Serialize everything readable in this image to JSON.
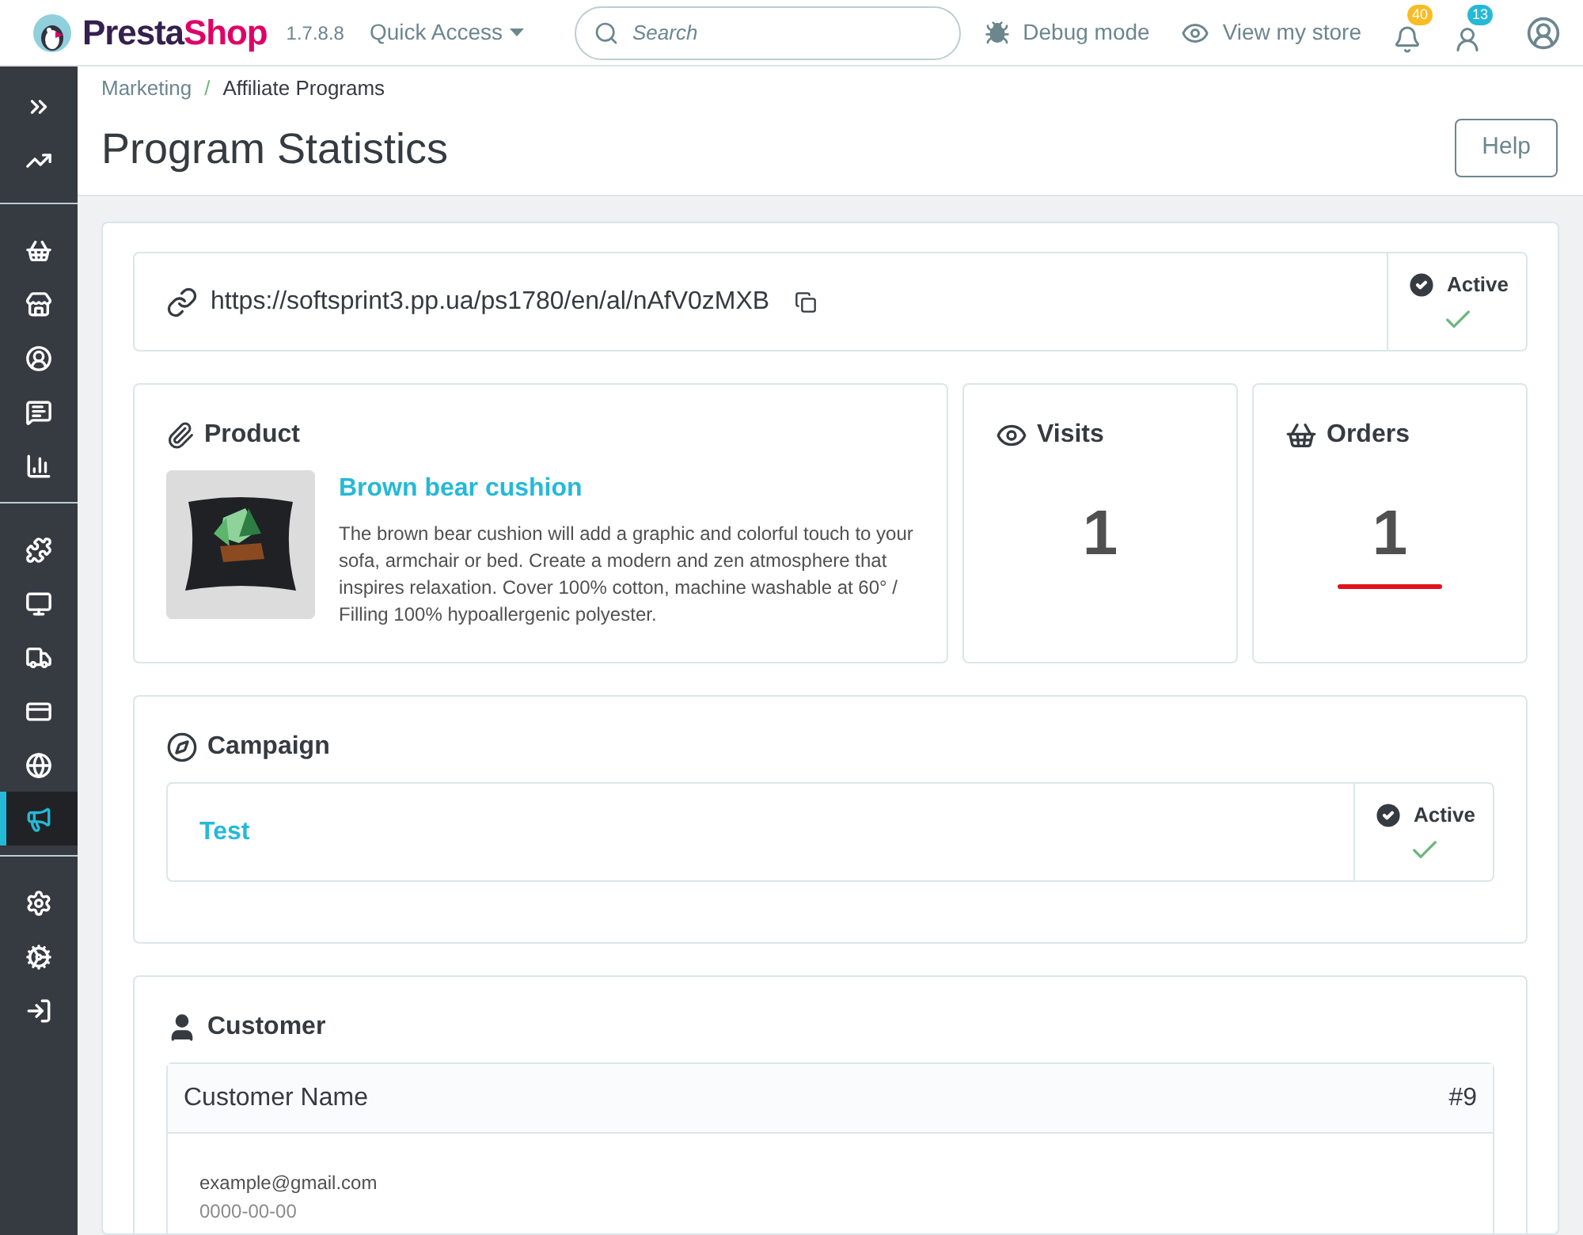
{
  "header": {
    "brand": "PrestaShop",
    "version": "1.7.8.8",
    "quick_access": "Quick Access",
    "search": {
      "placeholder": "Search"
    },
    "debug": "Debug mode",
    "view_store": "View my store",
    "badges": [
      {
        "kind": "bell",
        "count": "40",
        "color": "#fbbb22"
      },
      {
        "kind": "customers",
        "count": "13",
        "color": "#25b9d7"
      }
    ]
  },
  "sidebar": {
    "groups": [
      [
        {
          "kind": "expand",
          "selected": false
        },
        {
          "kind": "stats",
          "selected": false
        }
      ],
      [
        {
          "kind": "orders",
          "selected": false
        },
        {
          "kind": "catalog",
          "selected": false
        },
        {
          "kind": "customers",
          "selected": false
        },
        {
          "kind": "messages",
          "selected": false
        },
        {
          "kind": "reports",
          "selected": false
        }
      ],
      [
        {
          "kind": "modules",
          "selected": false
        },
        {
          "kind": "design",
          "selected": false
        },
        {
          "kind": "shipping",
          "selected": false
        },
        {
          "kind": "payment",
          "selected": false
        },
        {
          "kind": "international",
          "selected": false
        },
        {
          "kind": "marketing",
          "selected": true
        }
      ],
      [
        {
          "kind": "settings",
          "selected": false
        },
        {
          "kind": "advanced",
          "selected": false
        },
        {
          "kind": "logout",
          "selected": false
        }
      ]
    ]
  },
  "breadcrumb": [
    "Marketing",
    "/",
    "Affiliate Programs"
  ],
  "page_title": "Program Statistics",
  "help_button": "Help",
  "link": {
    "url": "https://softsprint3.pp.ua/ps1780/en/al/nAfV0zMXB",
    "status": "Active",
    "active": true
  },
  "product": {
    "heading": "Product",
    "name": "Brown bear cushion",
    "description": "The brown bear cushion will add a graphic and colorful touch to your sofa, armchair or bed. Create a modern and zen atmosphere that inspires relaxation. Cover 100% cotton, machine washable at 60° / Filling 100% hypoallergenic polyester."
  },
  "stats": [
    {
      "kind": "visits",
      "label": "Visits",
      "value": "1"
    },
    {
      "kind": "orders",
      "label": "Orders",
      "value": "1"
    }
  ],
  "campaign": {
    "heading": "Campaign",
    "name": "Test",
    "status": "Active",
    "active": true
  },
  "customer": {
    "heading": "Customer",
    "name": "Customer Name",
    "id": "#9",
    "email": "example@gmail.com",
    "date": "0000-00-00"
  }
}
